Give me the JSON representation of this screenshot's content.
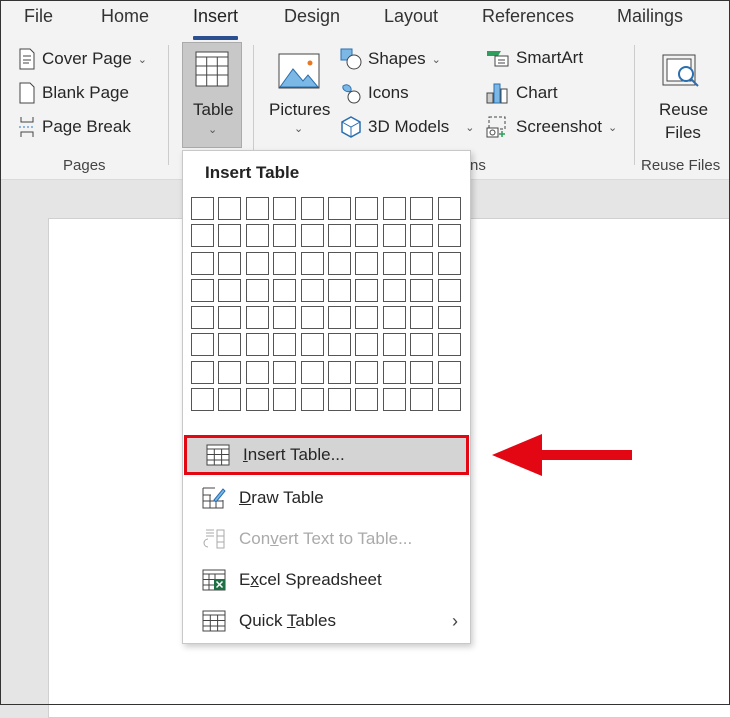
{
  "tabs": [
    "File",
    "Home",
    "Insert",
    "Design",
    "Layout",
    "References",
    "Mailings"
  ],
  "active_tab": "Insert",
  "ribbon": {
    "pages": {
      "cover_page": "Cover Page",
      "blank_page": "Blank Page",
      "page_break": "Page Break",
      "label": "Pages"
    },
    "table": "Table",
    "pictures": "Pictures",
    "shapes": "Shapes",
    "icons": "Icons",
    "models": "3D Models",
    "smartart": "SmartArt",
    "chart": "Chart",
    "screenshot": "Screenshot",
    "illustrations_label_fragment": "ns",
    "reuse": {
      "line1": "Reuse",
      "line2": "Files",
      "label": "Reuse Files"
    }
  },
  "menu": {
    "title": "Insert Table",
    "grid": {
      "columns": 10,
      "rows": 8
    },
    "items": [
      {
        "pre": "",
        "accel": "I",
        "post": "nsert Table...",
        "icon": "table-icon",
        "highlighted": true
      },
      {
        "pre": "",
        "accel": "D",
        "post": "raw Table",
        "icon": "draw-table-icon"
      },
      {
        "pre": "Con",
        "accel": "v",
        "post": "ert Text to Table...",
        "icon": "convert-text-icon",
        "disabled": true
      },
      {
        "pre": "E",
        "accel": "x",
        "post": "cel Spreadsheet",
        "icon": "excel-icon"
      },
      {
        "pre": "Quick ",
        "accel": "T",
        "post": "ables",
        "icon": "quick-tables-icon",
        "submenu": true
      }
    ]
  },
  "colors": {
    "highlight_border": "#e30613",
    "arrow": "#e30613",
    "tab_underline": "#2b4f8f"
  }
}
